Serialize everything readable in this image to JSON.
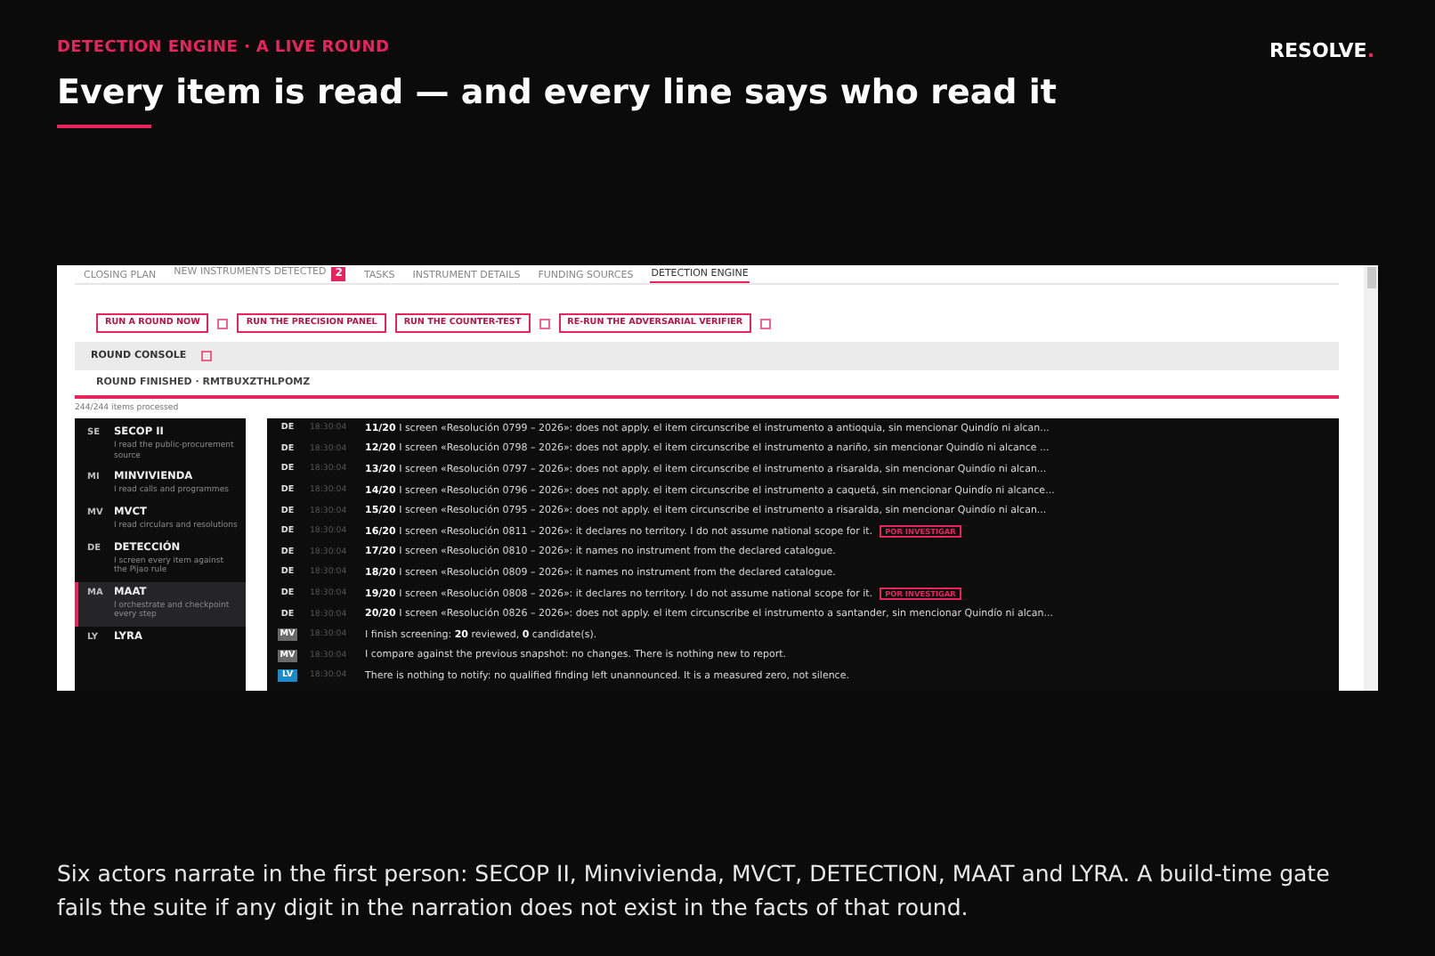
{
  "slide": {
    "kicker": "DETECTION ENGINE · A LIVE ROUND",
    "brand": "RESOLVE",
    "brand_mark": ".",
    "title": "Every item is read — and every line says who read it",
    "caption": "Six actors narrate in the first person: SECOP II, Minvivienda, MVCT, DETECTION, MAAT and LYRA. A build-time gate fails the suite if any digit in the narration does not exist in the facts of that round."
  },
  "tabs": [
    {
      "label": "CLOSING PLAN",
      "selected": false
    },
    {
      "label": "NEW INSTRUMENTS DETECTED",
      "badge": "2",
      "selected": false
    },
    {
      "label": "TASKS",
      "selected": false
    },
    {
      "label": "INSTRUMENT DETAILS",
      "selected": false
    },
    {
      "label": "FUNDING SOURCES",
      "selected": false
    },
    {
      "label": "DETECTION ENGINE",
      "selected": true
    }
  ],
  "actions": [
    {
      "label": "RUN A ROUND NOW",
      "info": true
    },
    {
      "label": "RUN THE PRECISION PANEL",
      "info": false
    },
    {
      "label": "RUN THE COUNTER-TEST",
      "info": true
    },
    {
      "label": "RE-RUN THE ADVERSARIAL VERIFIER",
      "info": true
    }
  ],
  "console": {
    "title": "ROUND CONSOLE",
    "status": "ROUND FINISHED · RMTBUXZTHLPOMZ",
    "progress": "244/244 items processed"
  },
  "actors": [
    {
      "code": "SE",
      "name": "SECOP II",
      "description": "I read the public-procurement source",
      "selected": false
    },
    {
      "code": "MI",
      "name": "MINVIVIENDA",
      "description": "I read calls and programmes",
      "selected": false
    },
    {
      "code": "MV",
      "name": "MVCT",
      "description": "I read circulars and resolutions",
      "selected": false
    },
    {
      "code": "DE",
      "name": "DETECCIÓN",
      "description": "I screen every item against the Pijao rule",
      "selected": false
    },
    {
      "code": "MA",
      "name": "MAAT",
      "description": "I orchestrate and checkpoint every step",
      "selected": true
    },
    {
      "code": "LY",
      "name": "LYRA",
      "selected": false
    }
  ],
  "log": [
    {
      "badge": "DE",
      "kind": "plain",
      "time": "18:30:04",
      "text": "**11/20** I screen «Resolución 0799 – 2026»: does not apply. el item circunscribe el instrumento a antioquia, sin mencionar Quindío ni alcan..."
    },
    {
      "badge": "DE",
      "kind": "plain",
      "time": "18:30:04",
      "text": "**12/20** I screen «Resolución 0798 – 2026»: does not apply. el item circunscribe el instrumento a nariño, sin mencionar Quindío ni alcance ..."
    },
    {
      "badge": "DE",
      "kind": "plain",
      "time": "18:30:04",
      "text": "**13/20** I screen «Resolución 0797 – 2026»: does not apply. el item circunscribe el instrumento a risaralda, sin mencionar Quindío ni alcan..."
    },
    {
      "badge": "DE",
      "kind": "plain",
      "time": "18:30:04",
      "text": "**14/20** I screen «Resolución 0796 – 2026»: does not apply. el item circunscribe el instrumento a caquetá, sin mencionar Quindío ni alcance..."
    },
    {
      "badge": "DE",
      "kind": "plain",
      "time": "18:30:04",
      "text": "**15/20** I screen «Resolución 0795 – 2026»: does not apply. el item circunscribe el instrumento a risaralda, sin mencionar Quindío ni alcan..."
    },
    {
      "badge": "DE",
      "kind": "plain",
      "time": "18:30:04",
      "text": "**16/20** I screen «Resolución 0811 – 2026»: it declares no territory. I do not assume national scope for it.",
      "tag": "POR INVESTIGAR"
    },
    {
      "badge": "DE",
      "kind": "plain",
      "time": "18:30:04",
      "text": "**17/20** I screen «Resolución 0810 – 2026»: it names no instrument from the declared catalogue."
    },
    {
      "badge": "DE",
      "kind": "plain",
      "time": "18:30:04",
      "text": "**18/20** I screen «Resolución 0809 – 2026»: it names no instrument from the declared catalogue."
    },
    {
      "badge": "DE",
      "kind": "plain",
      "time": "18:30:04",
      "text": "**19/20** I screen «Resolución 0808 – 2026»: it declares no territory. I do not assume national scope for it.",
      "tag": "POR INVESTIGAR"
    },
    {
      "badge": "DE",
      "kind": "plain",
      "time": "18:30:04",
      "text": "**20/20** I screen «Resolución 0826 – 2026»: does not apply. el item circunscribe el instrumento a santander, sin mencionar Quindío ni alcan..."
    },
    {
      "badge": "MV",
      "kind": "grey",
      "time": "18:30:04",
      "text": "I finish screening: **20** reviewed, **0** candidate(s)."
    },
    {
      "badge": "MV",
      "kind": "grey",
      "time": "18:30:04",
      "text": "I compare against the previous snapshot: no changes. There is nothing new to report."
    },
    {
      "badge": "LV",
      "kind": "blue",
      "time": "18:30:04",
      "text": "There is nothing to notify: no qualified finding left unannounced. It is a measured zero, not silence."
    }
  ]
}
